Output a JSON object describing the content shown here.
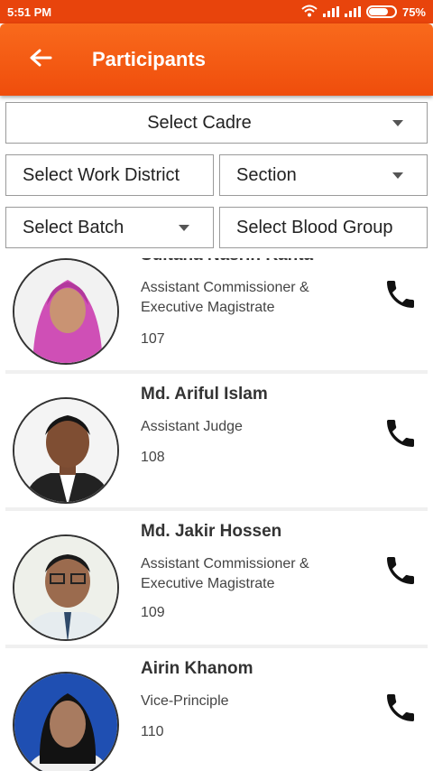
{
  "status_bar": {
    "time": "5:51 PM",
    "battery": "75%",
    "battery_level": 0.75
  },
  "header": {
    "title": "Participants",
    "back_icon": "arrow-left-icon"
  },
  "filters": {
    "cadre": "Select Cadre",
    "work_district": "Select Work District",
    "section": "Section",
    "batch": "Select Batch",
    "blood_group": "Select Blood Group"
  },
  "participants": [
    {
      "name": "Sultana Nasrin Kanta",
      "designation": "Assistant Commissioner & Executive Magistrate",
      "number": "107"
    },
    {
      "name": "Md. Ariful Islam",
      "designation": "Assistant Judge",
      "number": "108"
    },
    {
      "name": "Md. Jakir Hossen",
      "designation": "Assistant Commissioner & Executive Magistrate",
      "number": "109"
    },
    {
      "name": "Airin Khanom",
      "designation": "Vice-Principle",
      "number": "110"
    }
  ],
  "colors": {
    "accent": "#ef4d0c",
    "status_bar": "#e8440c"
  }
}
